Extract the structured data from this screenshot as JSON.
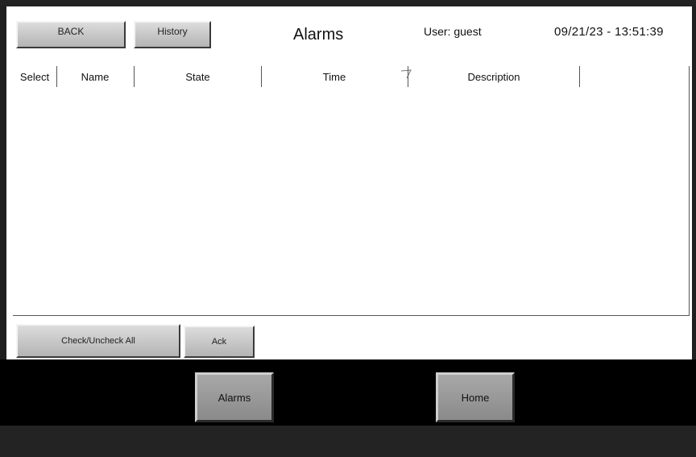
{
  "header": {
    "back_label": "BACK",
    "history_label": "History",
    "title": "Alarms",
    "user_label": "User: guest",
    "datetime": "09/21/23 - 13:51:39"
  },
  "table": {
    "columns": [
      "Select",
      "Name",
      "State",
      "Time",
      "Description"
    ],
    "sort_column": "Time",
    "rows": []
  },
  "actions": {
    "check_all_label": "Check/Uncheck All",
    "ack_label": "Ack"
  },
  "nav": {
    "alarms_label": "Alarms",
    "home_label": "Home"
  }
}
